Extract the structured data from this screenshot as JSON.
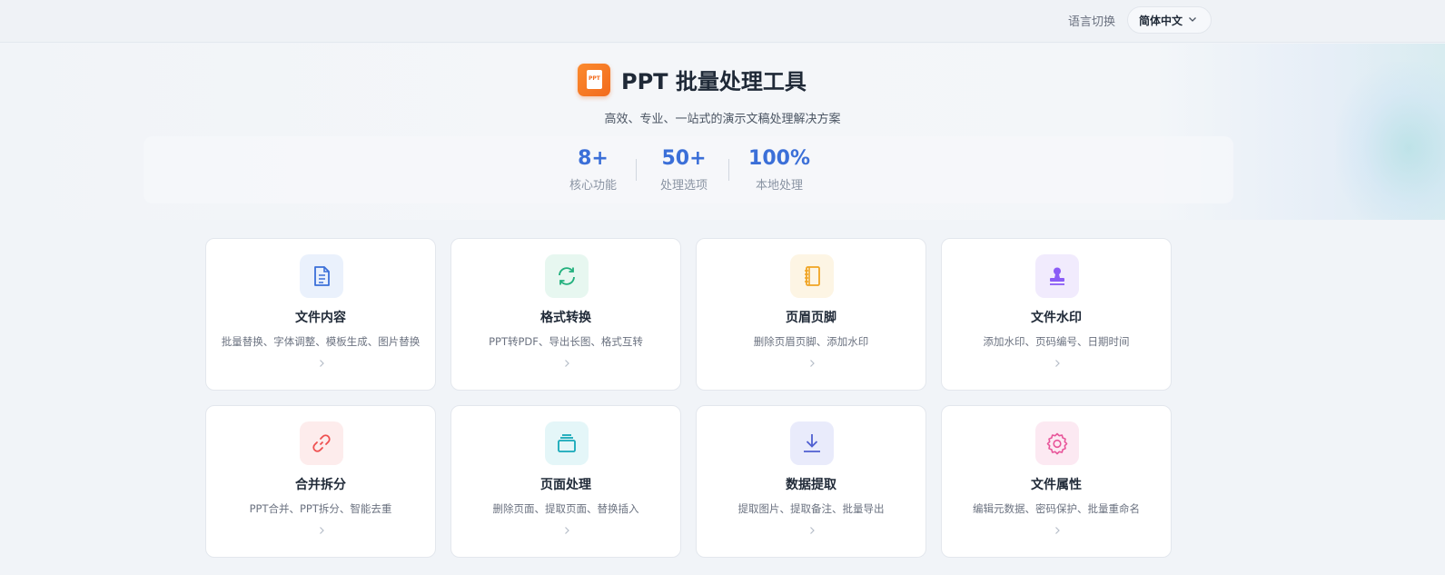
{
  "topbar": {
    "lang_label": "语言切换",
    "lang_selected": "简体中文"
  },
  "hero": {
    "title": "PPT 批量处理工具",
    "logo_text": "PPT",
    "subtitle": "高效、专业、一站式的演示文稿处理解决方案",
    "stats": [
      {
        "value": "8+",
        "label": "核心功能"
      },
      {
        "value": "50+",
        "label": "处理选项"
      },
      {
        "value": "100%",
        "label": "本地处理"
      }
    ]
  },
  "cards": [
    {
      "name": "文件内容",
      "desc": "批量替换、字体调整、模板生成、图片替换",
      "icon": "document-icon",
      "color": "#3b6fd8",
      "bg": "#eaf1fc"
    },
    {
      "name": "格式转换",
      "desc": "PPT转PDF、导出长图、格式互转",
      "icon": "refresh-icon",
      "color": "#22b07d",
      "bg": "#e7f7f0"
    },
    {
      "name": "页眉页脚",
      "desc": "删除页眉页脚、添加水印",
      "icon": "notebook-icon",
      "color": "#f0a422",
      "bg": "#fdf5e4"
    },
    {
      "name": "文件水印",
      "desc": "添加水印、页码编号、日期时间",
      "icon": "stamp-icon",
      "color": "#8b5cf6",
      "bg": "#f1ebfd"
    },
    {
      "name": "合并拆分",
      "desc": "PPT合并、PPT拆分、智能去重",
      "icon": "link-icon",
      "color": "#ef4f4f",
      "bg": "#fdecec"
    },
    {
      "name": "页面处理",
      "desc": "删除页面、提取页面、替换插入",
      "icon": "layers-icon",
      "color": "#14a8b8",
      "bg": "#e4f6f8"
    },
    {
      "name": "数据提取",
      "desc": "提取图片、提取备注、批量导出",
      "icon": "download-icon",
      "color": "#4f5fd1",
      "bg": "#e9ebfb"
    },
    {
      "name": "文件属性",
      "desc": "编辑元数据、密码保护、批量重命名",
      "icon": "gear-icon",
      "color": "#e8559a",
      "bg": "#fce9f2"
    }
  ]
}
